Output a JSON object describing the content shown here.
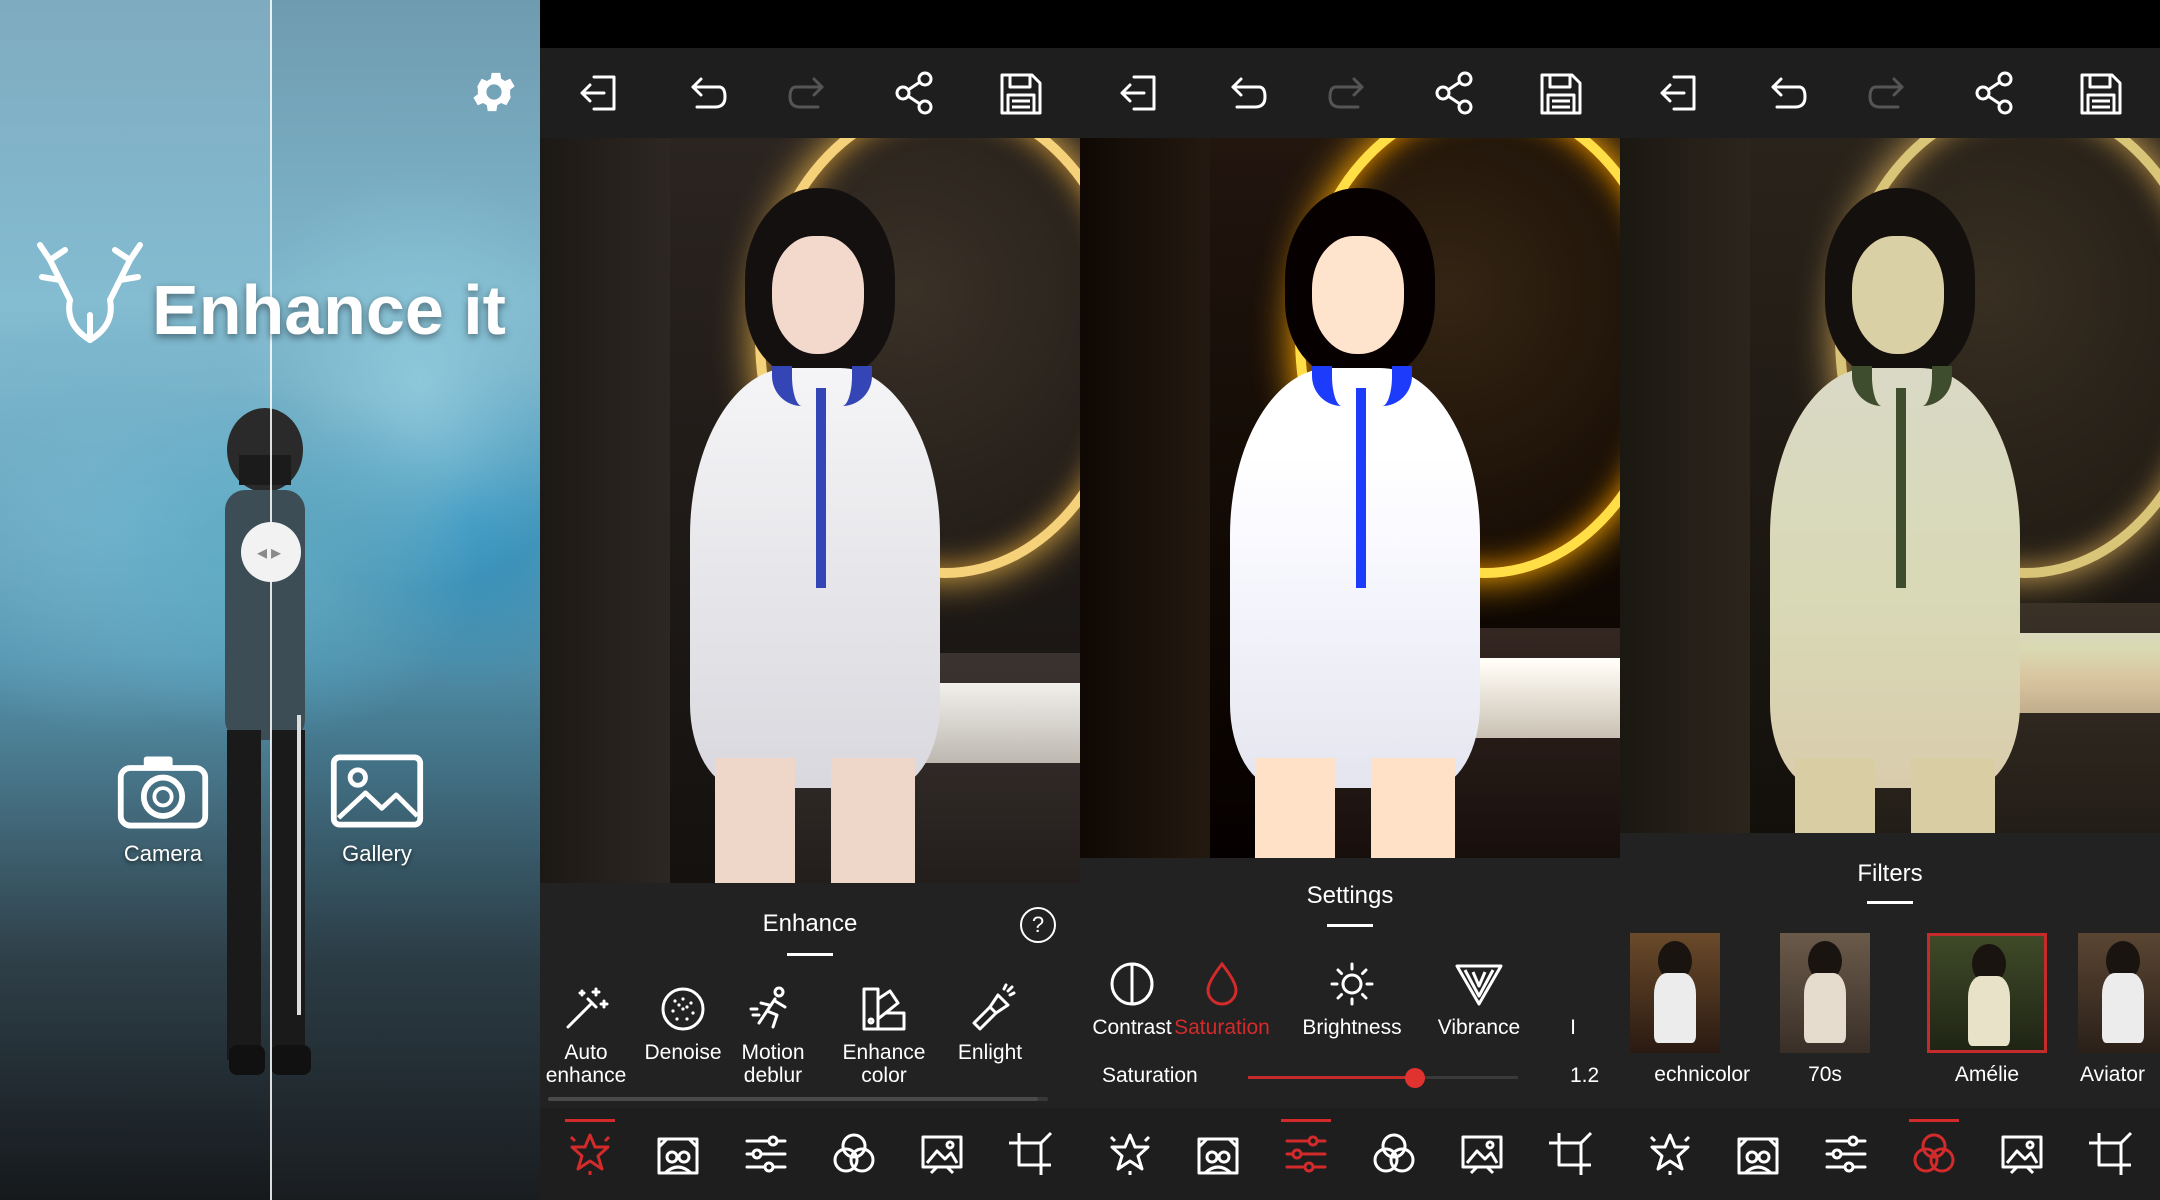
{
  "splash": {
    "brand": "Enhance it",
    "camera_label": "Camera",
    "gallery_label": "Gallery",
    "icons": [
      "settings-gear-icon",
      "deer-logo-icon",
      "compare-handle-icon",
      "camera-icon",
      "gallery-icon"
    ]
  },
  "toolbar_icons": [
    "exit-icon",
    "undo-icon",
    "redo-icon",
    "share-icon",
    "save-icon"
  ],
  "bottom_nav_icons": [
    "enhance-sparkle-icon",
    "portrait-enhance-icon",
    "adjust-sliders-icon",
    "filters-circles-icon",
    "image-effects-icon",
    "crop-icon"
  ],
  "enhance_panel": {
    "title": "Enhance",
    "help": "?",
    "tools": [
      {
        "label_line1": "Auto",
        "label_line2": "enhance",
        "icon": "magic-wand-icon"
      },
      {
        "label_line1": "Denoise",
        "label_line2": "",
        "icon": "denoise-icon"
      },
      {
        "label_line1": "Motion",
        "label_line2": "deblur",
        "icon": "running-figure-icon"
      },
      {
        "label_line1": "Enhance",
        "label_line2": "color",
        "icon": "color-swatch-icon"
      },
      {
        "label_line1": "Enlight",
        "label_line2": "",
        "icon": "flashlight-icon"
      }
    ],
    "active_nav": 0
  },
  "settings_panel": {
    "title": "Settings",
    "tools": [
      {
        "label": "Contrast",
        "icon": "contrast-icon"
      },
      {
        "label": "Saturation",
        "icon": "saturation-drop-icon"
      },
      {
        "label": "Brightness",
        "icon": "brightness-sun-icon"
      },
      {
        "label": "Vibrance",
        "icon": "vibrance-triangle-icon"
      },
      {
        "label": "I",
        "icon": ""
      }
    ],
    "active_tool": 1,
    "slider": {
      "label": "Saturation",
      "value": "1.2",
      "fraction": 0.62
    },
    "active_nav": 2
  },
  "filters_panel": {
    "title": "Filters",
    "filters": [
      {
        "name": "Technicolor",
        "display": "echnicolor"
      },
      {
        "name": "70s",
        "display": "70s"
      },
      {
        "name": "Amélie",
        "display": "Amélie"
      },
      {
        "name": "Aviator",
        "display": "Aviator"
      }
    ],
    "selected": 2,
    "active_nav": 3
  },
  "colors": {
    "accent": "#d32b2b",
    "panel_bg": "#1e1e1e",
    "text": "#ffffff"
  }
}
